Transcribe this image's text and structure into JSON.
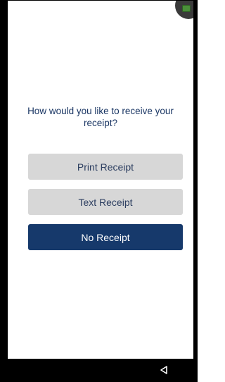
{
  "prompt": {
    "text": "How would you like to receive your receipt?"
  },
  "buttons": {
    "print_label": "Print Receipt",
    "text_label": "Text Receipt",
    "none_label": "No Receipt"
  },
  "icons": {
    "corner_app": "app-launcher-icon",
    "nav_back": "back-icon"
  },
  "colors": {
    "primary": "#16396b",
    "secondary": "#d7d7d7",
    "prompt_text": "#193563"
  }
}
